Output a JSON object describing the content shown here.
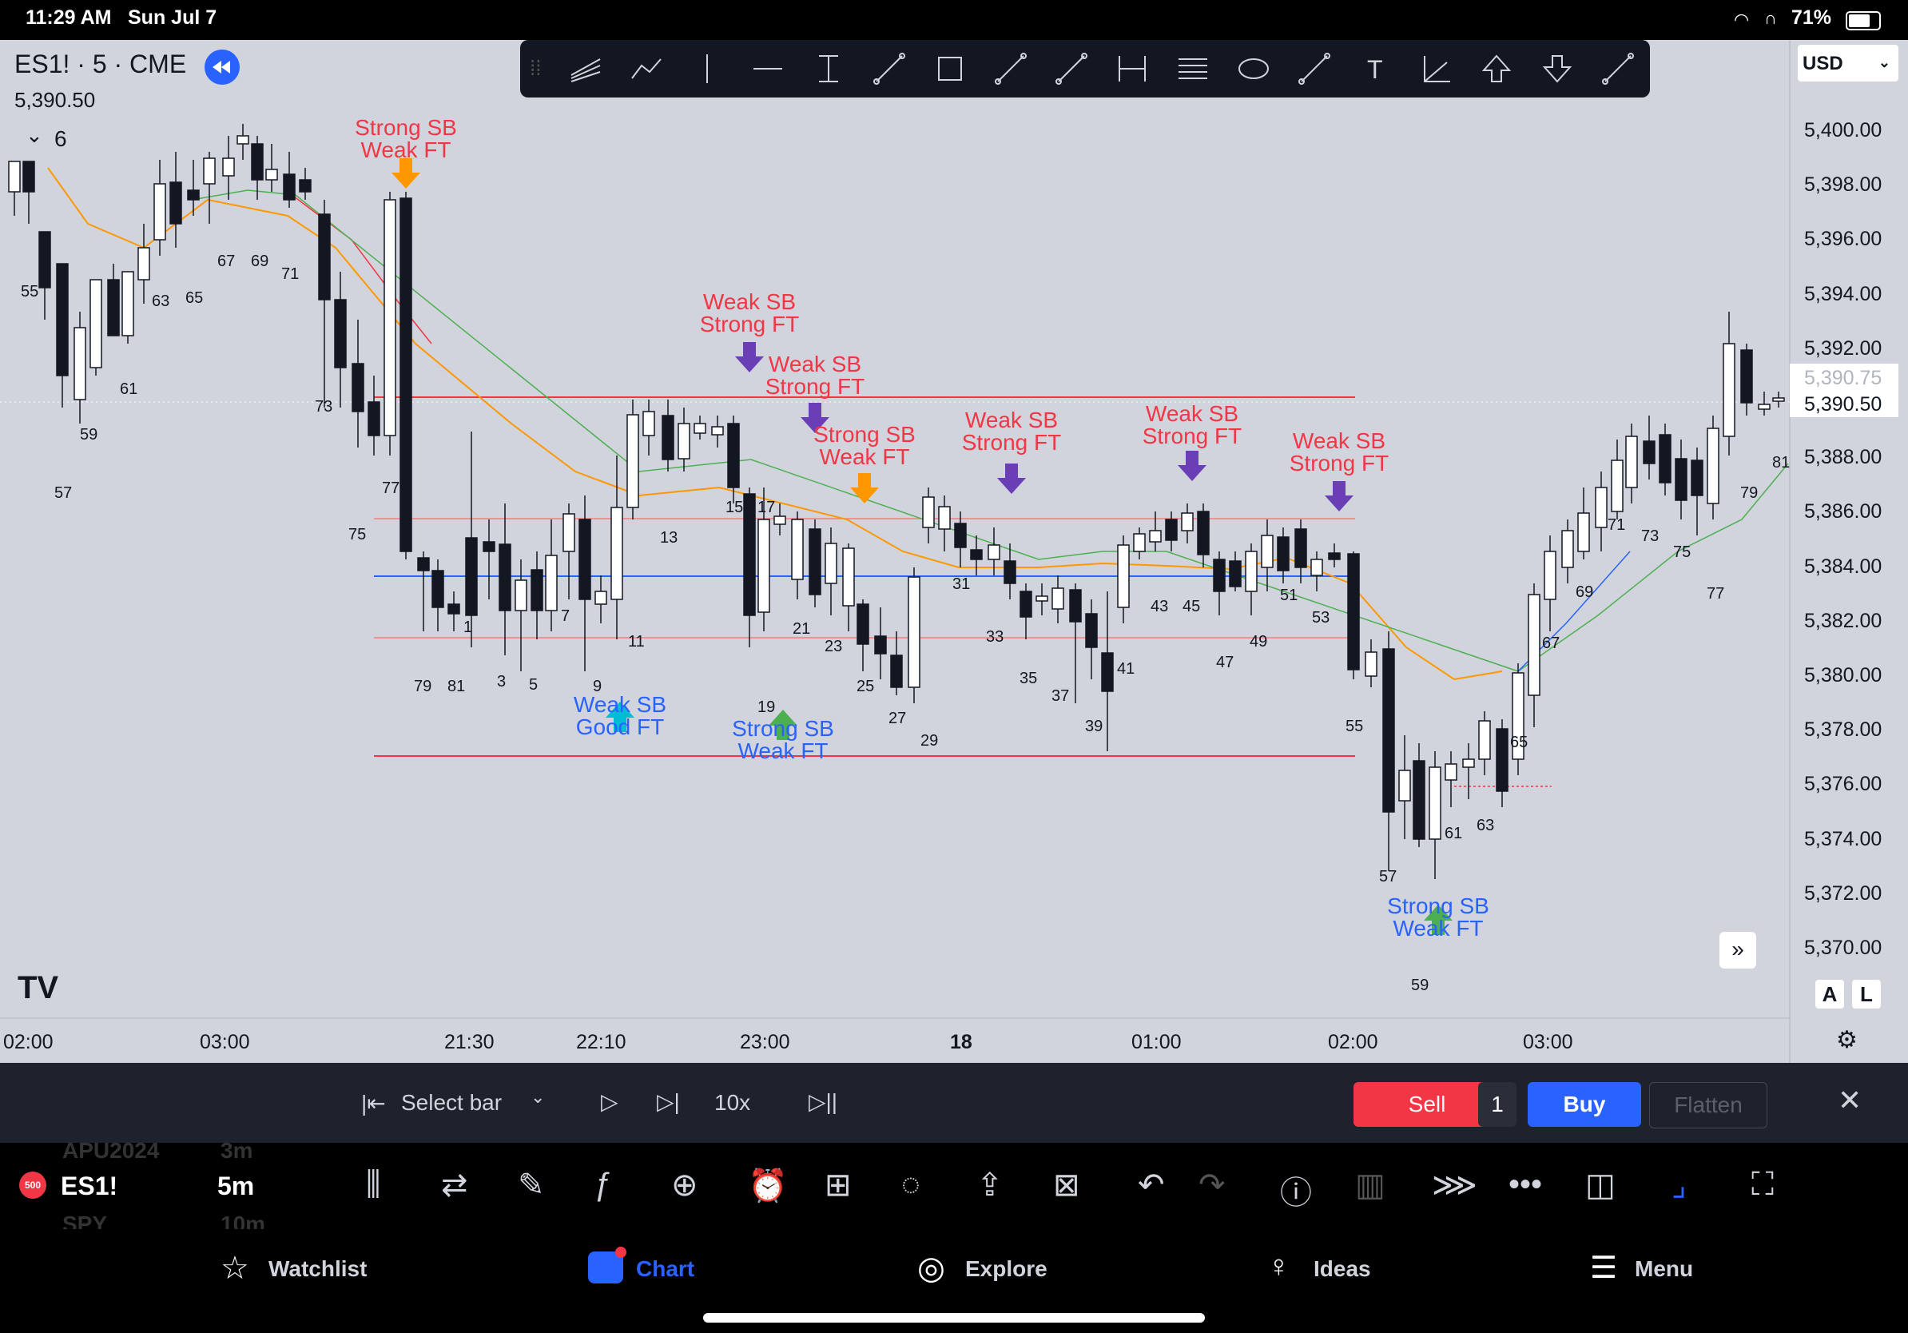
{
  "status_bar": {
    "time": "11:29 AM",
    "date": "Sun Jul 7",
    "battery": "71%"
  },
  "header": {
    "symbol_line": "ES1! · 5 · CME",
    "last_price": "5,390.50",
    "indicator_count": "6",
    "currency": "USD"
  },
  "price_axis": {
    "labels": [
      "5,400.00",
      "5,398.00",
      "5,396.00",
      "5,394.00",
      "5,392.00",
      "5,390.00",
      "5,388.00",
      "5,386.00",
      "5,384.00",
      "5,382.00",
      "5,380.00",
      "5,378.00",
      "5,376.00",
      "5,374.00",
      "5,372.00",
      "5,370.00"
    ],
    "bid_tag": "5,390.75",
    "last_tag": "5,390.50"
  },
  "time_axis": {
    "labels": [
      "02:00",
      "03:00",
      "21:30",
      "22:10",
      "23:00",
      "18",
      "01:00",
      "02:00",
      "03:00"
    ]
  },
  "annotations": [
    {
      "line1": "Strong SB",
      "line2": "Weak FT",
      "color": "red"
    },
    {
      "line1": "Weak SB",
      "line2": "Strong FT",
      "color": "red"
    },
    {
      "line1": "Weak SB",
      "line2": "Strong FT",
      "color": "red"
    },
    {
      "line1": "Strong SB",
      "line2": "Weak FT",
      "color": "red"
    },
    {
      "line1": "Weak SB",
      "line2": "Strong FT",
      "color": "red"
    },
    {
      "line1": "Weak SB",
      "line2": "Strong FT",
      "color": "red"
    },
    {
      "line1": "Weak SB",
      "line2": "Strong FT",
      "color": "red"
    },
    {
      "line1": "Weak SB",
      "line2": "Good FT",
      "color": "blue"
    },
    {
      "line1": "Strong SB",
      "line2": "Weak FT",
      "color": "blue"
    },
    {
      "line1": "Strong SB",
      "line2": "Weak FT",
      "color": "blue"
    }
  ],
  "bar_numbers": [
    "55",
    "57",
    "59",
    "61",
    "63",
    "65",
    "67",
    "69",
    "71",
    "73",
    "75",
    "77",
    "79",
    "81",
    "1",
    "3",
    "5",
    "7",
    "9",
    "11",
    "13",
    "15",
    "17",
    "19",
    "21",
    "23",
    "25",
    "27",
    "29",
    "31",
    "33",
    "35",
    "37",
    "39",
    "41",
    "43",
    "45",
    "47",
    "49",
    "51",
    "53",
    "55",
    "57",
    "59",
    "61",
    "63",
    "65",
    "67",
    "69",
    "71",
    "73",
    "75",
    "77",
    "79",
    "81"
  ],
  "replay_bar": {
    "select_bar": "Select bar",
    "speed": "10x",
    "sell": "Sell",
    "quantity": "1",
    "buy": "Buy",
    "flatten": "Flatten"
  },
  "bottom_toolbar": {
    "badge": "500",
    "symbol": "ES1!",
    "interval": "5m",
    "ghost_symbol_above": "APU2024",
    "ghost_interval_above": "3m",
    "ghost_symbol_below": "SPY",
    "ghost_interval_below": "10m"
  },
  "tab_bar": {
    "watchlist": "Watchlist",
    "chart": "Chart",
    "explore": "Explore",
    "ideas": "Ideas",
    "menu": "Menu"
  },
  "al_buttons": {
    "a": "A",
    "l": "L"
  },
  "colors": {
    "chart_bg": "#d1d4dc",
    "accent": "#2962ff",
    "sell": "#f23645",
    "annotation_red": "#f23645",
    "annotation_blue": "#2962ff"
  }
}
